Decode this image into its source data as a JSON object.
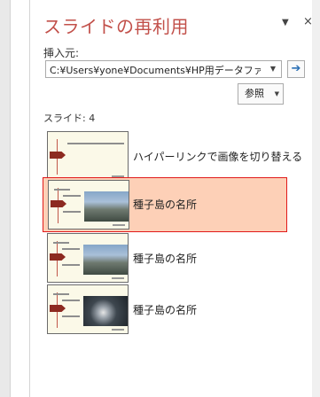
{
  "pane": {
    "title": "スライドの再利用",
    "dropdown_glyph": "▼",
    "close_glyph": "×"
  },
  "insert_from": {
    "label": "挿入元:",
    "path_value": "C:¥Users¥yone¥Documents¥HP用データファ",
    "dropdown_glyph": "▼",
    "go_glyph": "➔"
  },
  "browse": {
    "label": "参照",
    "caret": "▼"
  },
  "slides": {
    "count_label": "スライド: 4",
    "items": [
      {
        "title": "ハイパーリンクで画像を切り替える",
        "selected": false
      },
      {
        "title": "種子島の名所",
        "selected": true
      },
      {
        "title": "種子島の名所",
        "selected": false
      },
      {
        "title": "種子島の名所",
        "selected": false
      }
    ]
  },
  "colors": {
    "title": "#c2504a",
    "selection_fill": "#fdd0b7",
    "selection_border": "#e11b1b",
    "thumb_arrow": "#8d2a21"
  },
  "icons": [
    "dropdown-icon",
    "close-icon",
    "go-arrow-icon",
    "caret-down-icon"
  ]
}
